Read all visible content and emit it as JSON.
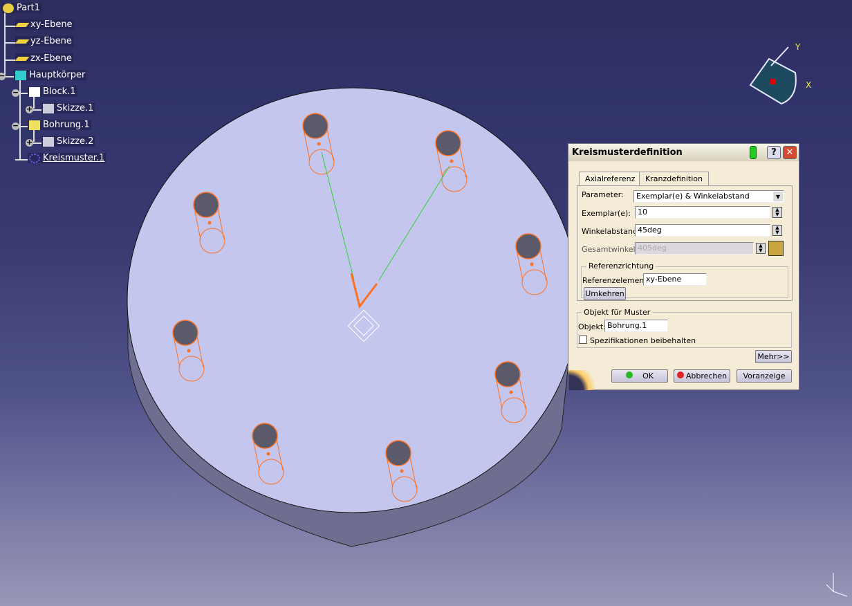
{
  "tree": {
    "root": "Part1",
    "items": [
      {
        "label": "xy-Ebene",
        "icon": "plane-icon"
      },
      {
        "label": "yz-Ebene",
        "icon": "plane-icon"
      },
      {
        "label": "zx-Ebene",
        "icon": "plane-icon"
      },
      {
        "label": "Hauptkörper",
        "icon": "body-icon"
      },
      {
        "label": "Block.1",
        "icon": "pad-icon"
      },
      {
        "label": "Skizze.1",
        "icon": "sketch-icon"
      },
      {
        "label": "Bohrung.1",
        "icon": "hole-icon"
      },
      {
        "label": "Skizze.2",
        "icon": "sketch-icon"
      },
      {
        "label": "Kreismuster.1",
        "icon": "circular-pattern-icon"
      }
    ]
  },
  "compass": {
    "y": "Y",
    "x": "X"
  },
  "dialog": {
    "title": "Kreismusterdefinition",
    "tabs": [
      "Axialreferenz",
      "Kranzdefinition"
    ],
    "active_tab": "Axialreferenz",
    "parameter_label": "Parameter:",
    "parameter_value": "Exemplar(e) & Winkelabstand",
    "instances_label": "Exemplar(e):",
    "instances_value": "10",
    "spacing_label": "Winkelabstand:",
    "spacing_value": "45deg",
    "total_label": "Gesamtwinkel:",
    "total_value": "405deg",
    "refdir_group": "Referenzrichtung",
    "refelem_label": "Referenzelement:",
    "refelem_value": "xy-Ebene",
    "reverse": "Umkehren",
    "object_group": "Objekt für Muster",
    "object_label": "Objekt:",
    "object_value": "Bohrung.1",
    "keep_spec_label": "Spezifikationen beibehalten",
    "keep_spec_checked": false,
    "more": "Mehr>>",
    "ok": "OK",
    "cancel": "Abbrechen",
    "preview": "Voranzeige"
  },
  "colors": {
    "hole_outline": "#ff7020",
    "pattern_line": "#30d030",
    "face": "#c4c6ee"
  }
}
